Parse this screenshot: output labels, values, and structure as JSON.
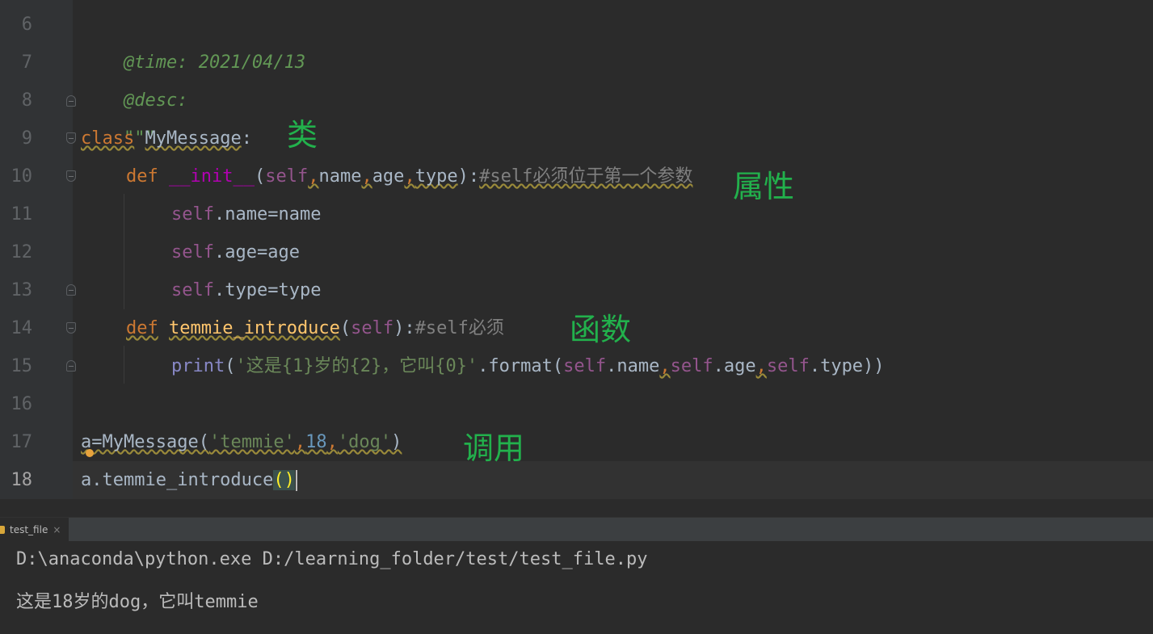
{
  "editor": {
    "line_numbers": [
      "6",
      "7",
      "8",
      "9",
      "10",
      "11",
      "12",
      "13",
      "14",
      "15",
      "16",
      "17",
      "18"
    ],
    "current_line": "18",
    "code": {
      "l6": "@time: 2021/04/13",
      "l7": "@desc:",
      "l8": "\"\"\"",
      "l9_kw": "class",
      "l9_name": "MyMessage",
      "l9_colon": ":",
      "l10_def": "def",
      "l10_init": "__init__",
      "l10_open": "(",
      "l10_self": "self",
      "l10_comma1": ",",
      "l10_name": "name",
      "l10_comma2": ",",
      "l10_age": "age",
      "l10_comma3": ",",
      "l10_type": "type",
      "l10_close": "):",
      "l10_comment": "#self必须位于第一个参数",
      "l11_self": "self",
      "l11_rest": ".name=name",
      "l12_self": "self",
      "l12_rest": ".age=age",
      "l13_self": "self",
      "l13_rest": ".type=type",
      "l14_def": "def",
      "l14_name": "temmie_introduce",
      "l14_open": "(",
      "l14_self": "self",
      "l14_close": "):",
      "l14_comment": "#self必须",
      "l15_print": "print",
      "l15_open": "(",
      "l15_str": "'这是{1}岁的{2}，它叫{0}'",
      "l15_format": ".format(",
      "l15_self1": "self",
      "l15_p1": ".name",
      "l15_c1": ",",
      "l15_self2": "self",
      "l15_p2": ".age",
      "l15_c2": ",",
      "l15_self3": "self",
      "l15_p3": ".type))",
      "l17_a": "a",
      "l17_call": "=MyMessage(",
      "l17_s1": "'temmie'",
      "l17_c1": ",",
      "l17_num": "18",
      "l17_c2": ",",
      "l17_s2": "'dog'",
      "l17_close": ")",
      "l18_text": "a.temmie_introduce",
      "l18_parens": "()"
    },
    "annotations": {
      "class": "类",
      "attribute": "属性",
      "function": "函数",
      "call": "调用"
    }
  },
  "run_panel": {
    "tab_label": "test_file",
    "tab_close": "×",
    "output": [
      "D:\\anaconda\\python.exe D:/learning_folder/test/test_file.py",
      "这是18岁的dog，它叫temmie"
    ]
  },
  "colors": {
    "background": "#2b2b2b",
    "keyword": "#cc7832",
    "self": "#94558d",
    "string": "#6a8759",
    "annotation": "#22b14c"
  }
}
